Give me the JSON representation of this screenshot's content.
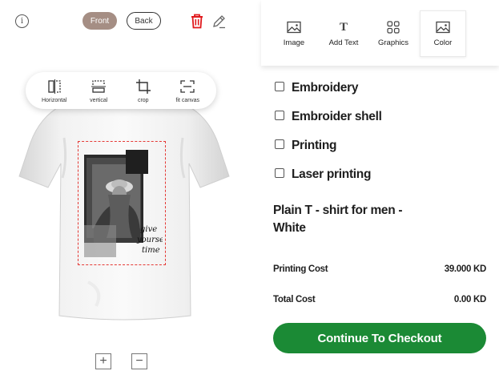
{
  "editor": {
    "info_icon": "info-icon",
    "front_label": "Front",
    "back_label": "Back",
    "delete_icon": "trash-icon",
    "edit_icon": "pencil-icon",
    "tools": [
      {
        "icon": "flip-horizontal-icon",
        "label": "Horizontal"
      },
      {
        "icon": "flip-vertical-icon",
        "label": "vertical"
      },
      {
        "icon": "crop-icon",
        "label": "crop"
      },
      {
        "icon": "fit-canvas-icon",
        "label": "fit canvas"
      }
    ],
    "zoom_in_icon": "plus-icon",
    "zoom_out_icon": "minus-icon",
    "design_text": "give yourself time"
  },
  "tabs": [
    {
      "icon": "image-icon",
      "label": "Image"
    },
    {
      "icon": "text-icon",
      "letter": "T",
      "label": "Add Text"
    },
    {
      "icon": "graphics-icon",
      "label": "Graphics"
    },
    {
      "icon": "color-icon",
      "label": "Color"
    }
  ],
  "options": [
    "Embroidery",
    "Embroider shell",
    "Printing",
    "Laser printing"
  ],
  "product": {
    "name_line1": "Plain T - shirt for men -",
    "name_line2": "White"
  },
  "costs": {
    "printing_label": "Printing Cost",
    "printing_value": "39.000 KD",
    "total_label": "Total Cost",
    "total_value": "0.00 KD"
  },
  "checkout_label": "Continue To Checkout",
  "colors": {
    "front_active": "#a58e84",
    "delete": "#e0191c",
    "checkout": "#1b8a35",
    "design_border": "#e53935"
  }
}
